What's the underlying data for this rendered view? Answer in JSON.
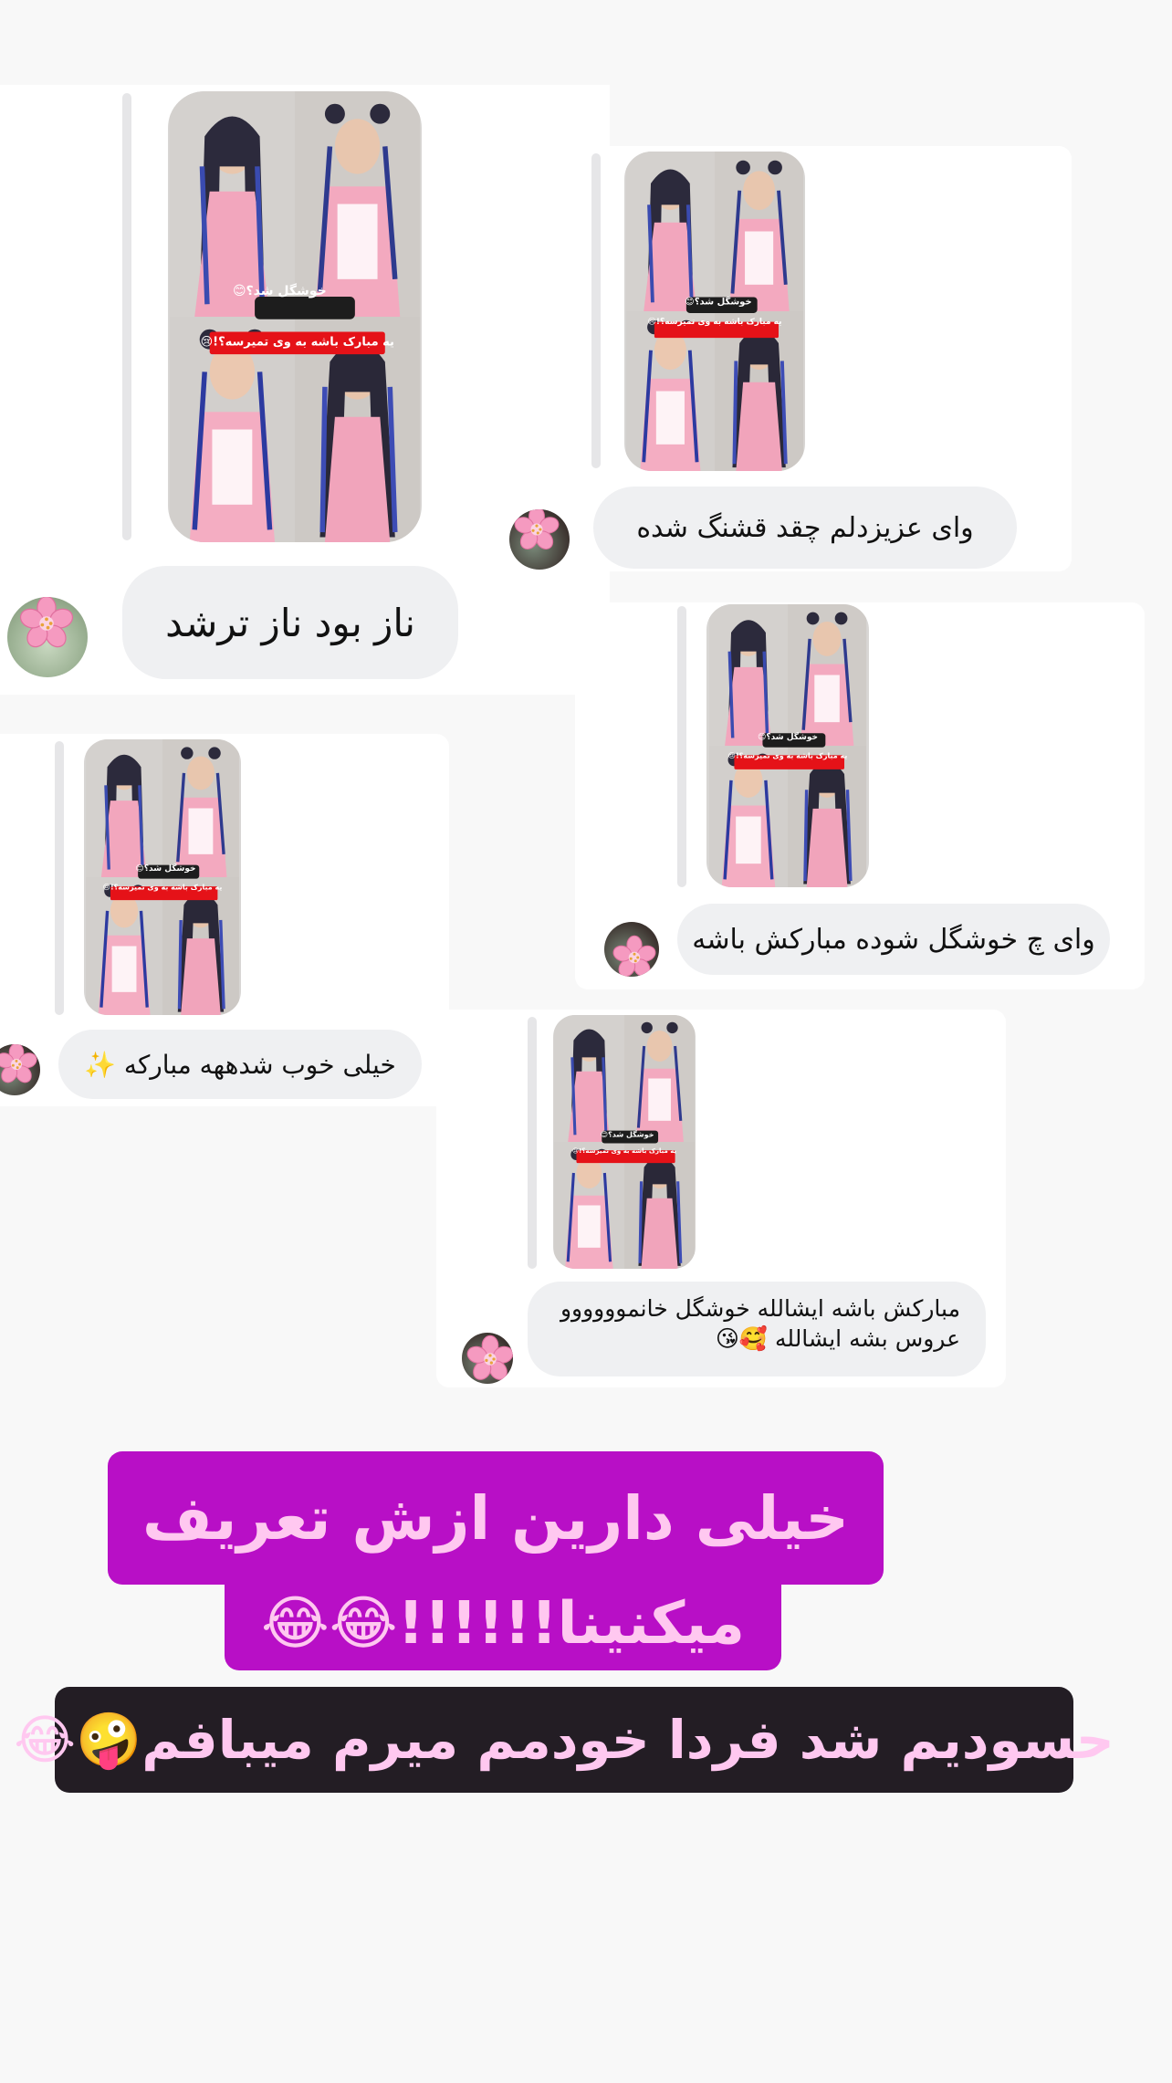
{
  "comments": [
    {
      "id": "c1",
      "text": "ناز بود ناز ترشد",
      "photo_label_1": "خوشگل شد؟😊",
      "photo_label_2": "یه مبارک باشه به وی تمیرسه؟!😢"
    },
    {
      "id": "c2",
      "text": "وای عزیزدلم چقد قشنگ شده",
      "photo_label_1": "خوشگل شد؟😊",
      "photo_label_2": "یه مبارک باشه به وی تمیرسه؟!😢"
    },
    {
      "id": "c3",
      "text": "وای چ خوشگل شوده مبارکش باشه",
      "photo_label_1": "خوشگل شد؟😊",
      "photo_label_2": "یه مبارک باشه به وی تمیرسه؟!😢"
    },
    {
      "id": "c4",
      "text": "خیلی خوب شدههه مبارکه ✨",
      "photo_label_1": "خوشگل شد؟😊",
      "photo_label_2": "یه مبارک باشه به وی تمیرسه؟!😢"
    },
    {
      "id": "c5",
      "text_line1": "مبارکش باشه ایشالله خوشگل خانموووووو",
      "text_line2": "عروس بشه ایشالله 🥰😘",
      "photo_label_1": "خوشگل شد؟😊",
      "photo_label_2": "یه مبارک باشه به وی تمیرسه؟!😢"
    }
  ],
  "sticker_1": {
    "line1": "خیلی دارین ازش تعریف",
    "line2": "میکنینا!!!!!!😂😂",
    "bg_color": "#b80fc6"
  },
  "sticker_2": {
    "text": "حسودیم شد فردا خودمم میرم میبافم🤪😂",
    "bg_color": "#231d24"
  },
  "avatar_icon": "cherry-blossom-icon",
  "colors": {
    "background": "#f8f8f8",
    "card": "#ffffff",
    "bubble": "#eff0f2",
    "sticker_text": "#ffc6ee"
  }
}
